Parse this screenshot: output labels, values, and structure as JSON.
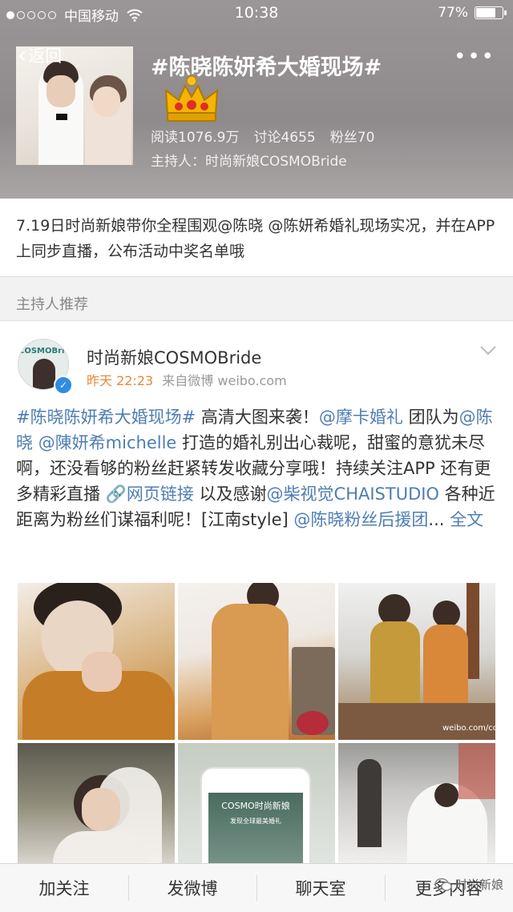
{
  "status_bar": {
    "carrier": "中国移动",
    "time": "10:38",
    "battery": "77%",
    "battery_level": 0.77
  },
  "nav": {
    "back_label": "返回",
    "more_label": "•••"
  },
  "topic": {
    "title": "#陈晓陈妍希大婚现场#",
    "stat_read": "阅读1076.9万",
    "stat_discuss": "讨论4655",
    "stat_fans": "粉丝70",
    "host": "主持人：时尚新娘COSMOBride"
  },
  "description": "7.19日时尚新娘带你全程围观@陈晓 @陈妍希婚礼现场实况，并在APP上同步直播，公布活动中奖名单哦",
  "section_label": "主持人推荐",
  "post": {
    "avatar_text": "COSMOBride",
    "author": "时尚新娘COSMOBride",
    "time": "昨天 22:23",
    "source": "来自微博 weibo.com",
    "segments": [
      {
        "text": "#陈晓陈妍希大婚现场#",
        "link": true
      },
      {
        "text": " 高清大图来袭！",
        "link": false
      },
      {
        "text": "@摩卡婚礼",
        "link": true
      },
      {
        "text": " 团队为",
        "link": false
      },
      {
        "text": "@陈晓",
        "link": true
      },
      {
        "text": " ",
        "link": false
      },
      {
        "text": "@陳妍希michelle",
        "link": true
      },
      {
        "text": " 打造的婚礼别出心裁呢，甜蜜的意犹未尽啊，还没看够的粉丝赶紧转发收藏分享哦！持续关注APP 还有更多精彩直播 ",
        "link": false
      },
      {
        "text": "🔗网页链接",
        "link": true
      },
      {
        "text": " 以及感谢",
        "link": false
      },
      {
        "text": "@柴视觉CHAISTUDIO",
        "link": true
      },
      {
        "text": " 各种近距离为粉丝们谋福利呢！[江南style] ",
        "link": false
      },
      {
        "text": "@陈晓粉丝后援团",
        "link": true
      },
      {
        "text": "... ",
        "link": false
      },
      {
        "text": "全文",
        "link": true
      }
    ],
    "photo_watermark": "weibo.com/cosmob",
    "phone_title": "COSMO时尚新娘",
    "phone_subtitle": "发现全球最美婚礼"
  },
  "bottom_bar": {
    "follow": "加关注",
    "post_weibo": "发微博",
    "chatroom": "聊天室",
    "more_content": "更多内容"
  },
  "watermark_logo": "时尚新娘",
  "colors": {
    "link": "#4f7db3",
    "time_orange": "#e9873a",
    "verified_blue": "#2f8ce0"
  }
}
